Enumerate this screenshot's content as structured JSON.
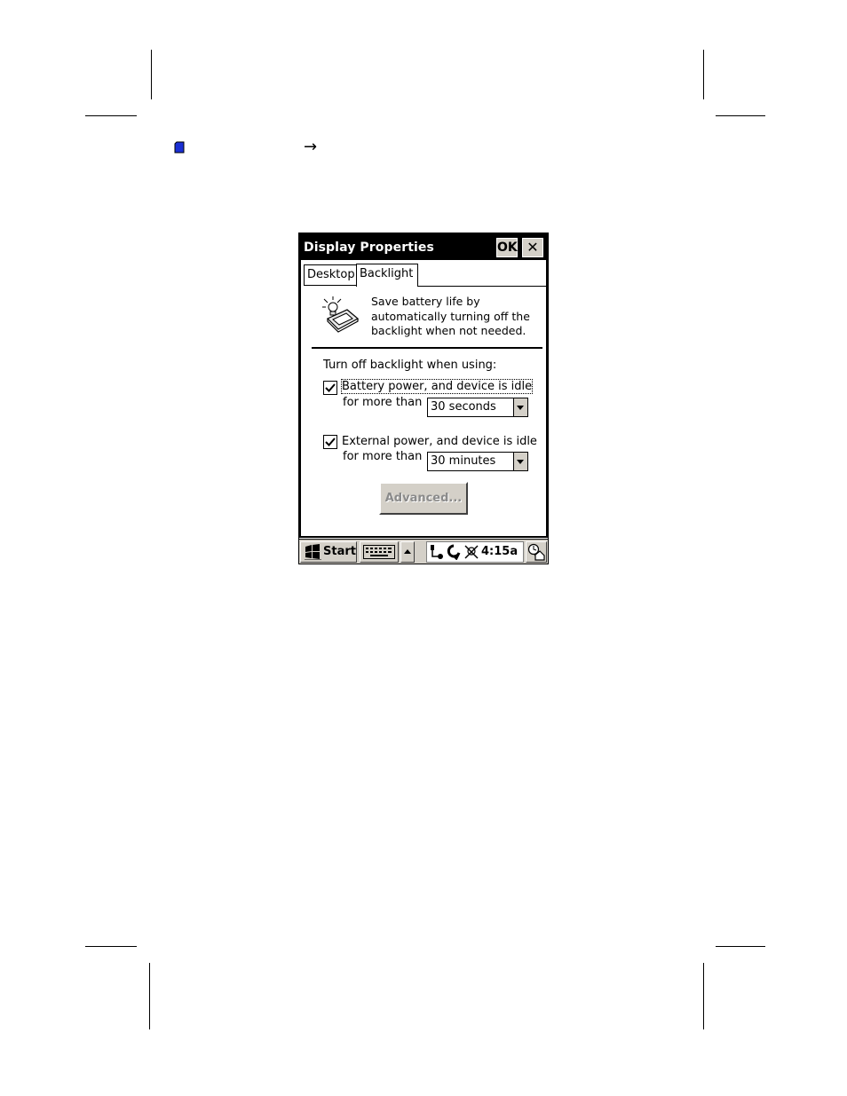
{
  "window": {
    "title": "Display Properties",
    "ok_label": "OK",
    "close_glyph": "✕"
  },
  "tabs": [
    {
      "label": "Desktop",
      "active": false
    },
    {
      "label": "Backlight",
      "active": true
    }
  ],
  "info": {
    "line1": "Save battery life by",
    "line2": "automatically turning off the",
    "line3": "backlight when not needed.",
    "icon": "backlight-bulb-icon"
  },
  "settings": {
    "section_label": "Turn off backlight when using:",
    "battery": {
      "checked": true,
      "label": "Battery power, and device is idle",
      "sub_label": "for more than",
      "selected": "30 seconds"
    },
    "external": {
      "checked": true,
      "label": "External power, and device is idle",
      "sub_label": "for more than",
      "selected": "30 minutes"
    },
    "advanced_label": "Advanced..."
  },
  "taskbar": {
    "start_label": "Start",
    "clock": "4:15a"
  },
  "page": {
    "arrow": "→"
  },
  "colors": {
    "titlebar": "#000000",
    "button_face": "#d4d0c8",
    "bullet": "#1a2fd4"
  }
}
